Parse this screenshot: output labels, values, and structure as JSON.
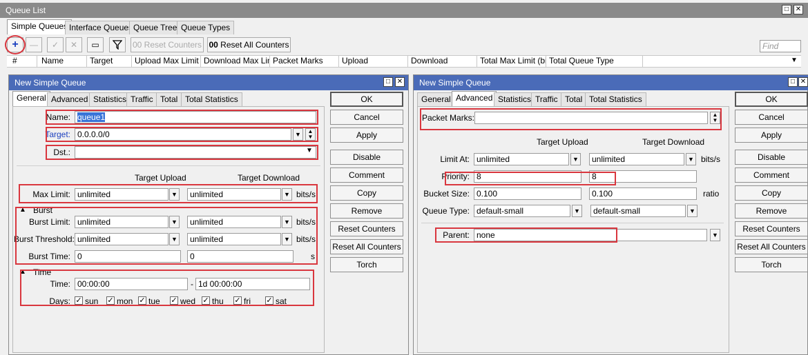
{
  "queue_list": {
    "title": "Queue List",
    "tabs": [
      "Simple Queues",
      "Interface Queues",
      "Queue Tree",
      "Queue Types"
    ],
    "toolbar": {
      "add": "+",
      "remove": "—",
      "enable": "✓",
      "disable": "✕",
      "comment": "▭",
      "reset_counters": "Reset Counters",
      "reset_all_counters": "Reset All Counters",
      "find_placeholder": "Find",
      "counter_glyph": "00"
    },
    "columns": [
      "#",
      "Name",
      "Target",
      "Upload Max Limit",
      "Download Max Limit",
      "Packet Marks",
      "Upload",
      "Download",
      "Total Max Limit (bi...",
      "Total Queue Type"
    ]
  },
  "dialog1": {
    "title": "New Simple Queue",
    "tabs": [
      "General",
      "Advanced",
      "Statistics",
      "Traffic",
      "Total",
      "Total Statistics"
    ],
    "name_label": "Name:",
    "name_value": "queue1",
    "target_label": "Target:",
    "target_value": "0.0.0.0/0",
    "dst_label": "Dst.:",
    "dst_value": "",
    "target_upload_header": "Target Upload",
    "target_download_header": "Target Download",
    "max_limit_label": "Max Limit:",
    "max_limit_upload": "unlimited",
    "max_limit_download": "unlimited",
    "bits_s": "bits/s",
    "burst_section": "Burst",
    "burst_limit_label": "Burst Limit:",
    "burst_limit_upload": "unlimited",
    "burst_limit_download": "unlimited",
    "burst_threshold_label": "Burst Threshold:",
    "burst_threshold_upload": "unlimited",
    "burst_threshold_download": "unlimited",
    "burst_time_label": "Burst Time:",
    "burst_time_upload": "0",
    "burst_time_download": "0",
    "seconds": "s",
    "time_section": "Time",
    "time_label": "Time:",
    "time_from": "00:00:00",
    "time_dash": "-",
    "time_to": "1d 00:00:00",
    "days_label": "Days:",
    "days": [
      "sun",
      "mon",
      "tue",
      "wed",
      "thu",
      "fri",
      "sat"
    ],
    "buttons": [
      "OK",
      "Cancel",
      "Apply",
      "Disable",
      "Comment",
      "Copy",
      "Remove",
      "Reset Counters",
      "Reset All Counters",
      "Torch"
    ]
  },
  "dialog2": {
    "title": "New Simple Queue",
    "tabs": [
      "General",
      "Advanced",
      "Statistics",
      "Traffic",
      "Total",
      "Total Statistics"
    ],
    "packet_marks_label": "Packet Marks:",
    "packet_marks_value": "",
    "target_upload_header": "Target Upload",
    "target_download_header": "Target Download",
    "limit_at_label": "Limit At:",
    "limit_at_upload": "unlimited",
    "limit_at_download": "unlimited",
    "bits_s": "bits/s",
    "priority_label": "Priority:",
    "priority_upload": "8",
    "priority_download": "8",
    "bucket_size_label": "Bucket Size:",
    "bucket_size_upload": "0.100",
    "bucket_size_download": "0.100",
    "ratio": "ratio",
    "queue_type_label": "Queue Type:",
    "queue_type_upload": "default-small",
    "queue_type_download": "default-small",
    "parent_label": "Parent:",
    "parent_value": "none",
    "buttons": [
      "OK",
      "Cancel",
      "Apply",
      "Disable",
      "Comment",
      "Copy",
      "Remove",
      "Reset Counters",
      "Reset All Counters",
      "Torch"
    ]
  },
  "window_controls": {
    "restore": "□",
    "close": "✕"
  }
}
